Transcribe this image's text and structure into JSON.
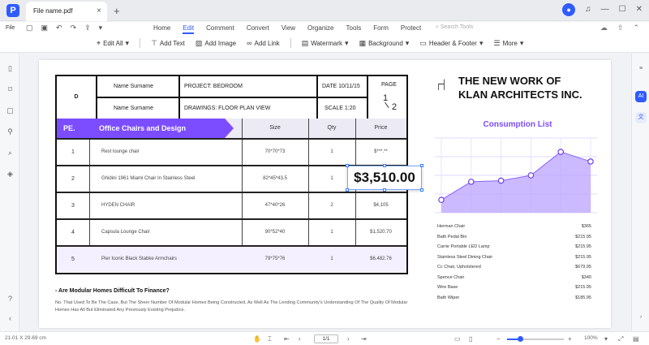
{
  "window": {
    "tab_title": "File name.pdf",
    "add_tab": "+",
    "close": "×"
  },
  "menu": {
    "file_label": "File",
    "items": [
      "Home",
      "Edit",
      "Comment",
      "Convert",
      "View",
      "Organize",
      "Tools",
      "Form",
      "Protect"
    ],
    "active": "Edit",
    "search_placeholder": "Search Tools"
  },
  "toolbar": {
    "edit_all": "Edit All",
    "add_text": "Add Text",
    "add_image": "Add Image",
    "add_link": "Add Link",
    "watermark": "Watermark",
    "background": "Background",
    "header_footer": "Header & Footer",
    "more": "More"
  },
  "document": {
    "logo_letter": "D",
    "name1": "Name Surname",
    "name2": "Name Surname",
    "project": "PROJECT: BEDROOM",
    "drawings": "DRAWINGS: FLOOR PLAN VIEW",
    "date": "DATE 10/11/15",
    "scale": "SCALE 1:20",
    "page_label": "PAGE",
    "page_num": "1",
    "page_total": "2",
    "table_head": {
      "no": "PE.",
      "title": "Office Chairs and Design",
      "size": "Size",
      "qty": "Qty",
      "price": "Price"
    },
    "rows": [
      {
        "n": "1",
        "name": "Rest lounge chair",
        "size": "70*70*73",
        "qty": "1",
        "price": "$***.**"
      },
      {
        "n": "2",
        "name": "Ghidini 1961 Miami Chair In Stainless Steel",
        "size": "82*45*43.5",
        "qty": "1",
        "price": ""
      },
      {
        "n": "3",
        "name": "HYDEN CHAIR",
        "size": "47*40*26",
        "qty": "2",
        "price": "$4,105"
      },
      {
        "n": "4",
        "name": "Capsula Lounge Chair",
        "size": "90*52*40",
        "qty": "1",
        "price": "$1,520.70"
      },
      {
        "n": "5",
        "name": "Pier Iconic Black Stabke Armchairs",
        "size": "79*75*76",
        "qty": "1",
        "price": "$6,482.76"
      }
    ],
    "selected_price": "$3,510.00",
    "question": "- Are Modular Homes Difficult To Finance?",
    "paragraph": "No. That Used To Be The Case, But The Sheer Number Of Modular Homes Being Constructed, As Well As The Lending Community's Understanding Of The Quality Of Modular Homes Has All But Eliminated Any Previously Existing Prejudice.",
    "company_title_1": "THE NEW WORK OF",
    "company_title_2": "KLAN ARCHITECTS INC.",
    "consumption_title": "Consumption List",
    "consumption": [
      {
        "item": "Herman Chair",
        "price": "$365"
      },
      {
        "item": "Bath Pedal Bin",
        "price": "$215.95"
      },
      {
        "item": "Carrie Portable LED Lamp",
        "price": "$215.95"
      },
      {
        "item": "Stainless Steel Dining Chair",
        "price": "$215.95"
      },
      {
        "item": "Cc Chair, Upholstered",
        "price": "$679.95"
      },
      {
        "item": "Spence Chair",
        "price": "$340"
      },
      {
        "item": "Wire Base",
        "price": "$215.95"
      },
      {
        "item": "Bath Wiper",
        "price": "$185.95"
      }
    ]
  },
  "chart_data": {
    "type": "area",
    "x": [
      1,
      2,
      3,
      4,
      5,
      6
    ],
    "values": [
      1.2,
      2.9,
      3.0,
      3.5,
      5.7,
      4.8
    ],
    "ylim": [
      0,
      7
    ],
    "grid": true,
    "color": "#7c4dff"
  },
  "status": {
    "dimensions": "21.01 X 29.69 cm",
    "page_indicator": "1/1",
    "zoom": "100%"
  },
  "colors": {
    "accent": "#2f5bff",
    "purple": "#7c4dff"
  }
}
